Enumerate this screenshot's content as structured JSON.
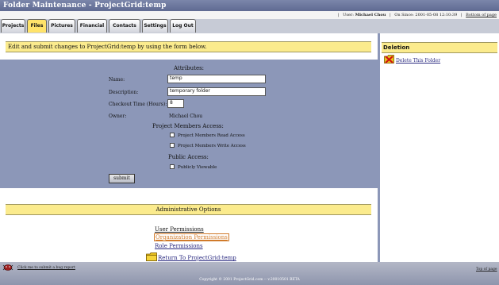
{
  "window": {
    "title": "Folder Maintenance - ProjectGrid:temp"
  },
  "info_bar": {
    "user_label": "User:",
    "user_name": "Michael Chou",
    "online_label": "On Since: 2001-05-08 12:10:39",
    "bottom_link": "Bottom of page"
  },
  "tabs": [
    "Projects",
    "Files",
    "Pictures",
    "Financial",
    "Contacts",
    "Settings",
    "Log Out"
  ],
  "active_tab": "Files",
  "main": {
    "instructions": "Edit and submit changes to ProjectGrid:temp by using the form below.",
    "attributes_heading": "Attributes:",
    "name_label": "Name:",
    "name_value": "temp",
    "description_label": "Description:",
    "description_value": "temporary folder",
    "checkout_label": "Checkout Time (Hours):",
    "checkout_value": "8",
    "owner_label": "Owner:",
    "owner_value": "Michael Chou",
    "members_heading": "Project Members Access:",
    "read_access_label": "Project Members Read Access",
    "write_access_label": "Project Members Write Access",
    "public_heading": "Public Access:",
    "public_label": "Publicly Viewable",
    "submit_label": "submit"
  },
  "admin": {
    "heading": "Administrative Options",
    "user_permissions": "User Permissions",
    "organization_permissions": "Organization Permissions",
    "role_permissions": "Role Permissions",
    "return_link": "Return To ProjectGrid:temp"
  },
  "sidebar": {
    "heading": "Deletion",
    "delete_link": "Delete This Folder"
  },
  "footer": {
    "bug_link": "Click me to submit a bug report",
    "top_link": "Top of page",
    "copyright": "Copyright © 2001 ProjectGrid.com -- v.20010501 BETA"
  },
  "colors": {
    "accent_yellow": "#fbeb8d",
    "active_tab": "#ffe36a",
    "background": "#8c97b8",
    "highlight_link": "#d07a2a",
    "link": "#2a2a80"
  }
}
